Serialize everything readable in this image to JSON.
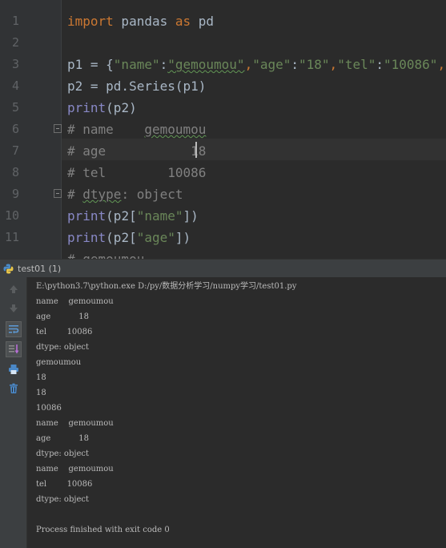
{
  "editor": {
    "line_numbers": [
      "1",
      "2",
      "3",
      "4",
      "5",
      "6",
      "7",
      "8",
      "9",
      "10",
      "11"
    ],
    "tokens": {
      "l1_import": "import",
      "l1_pandas": " pandas ",
      "l1_as": "as",
      "l1_pd": " pd",
      "l3_prefix": "p1 = {",
      "l3_k1": "\"name\"",
      "l3_c1": ":",
      "l3_v1": "\"gemoumou\"",
      "l3_s1": ",",
      "l3_k2": "\"age\"",
      "l3_c2": ":",
      "l3_v2": "\"18\"",
      "l3_s2": ",",
      "l3_k3": "\"tel\"",
      "l3_c3": ":",
      "l3_v3": "\"10086\"",
      "l3_s3": ",",
      "l3_end": "}",
      "l4": "p2 = pd.Series(p1)",
      "l5_print": "print",
      "l5_args": "(p2)",
      "l6_a": "# name    ",
      "l6_b": "gemoumou",
      "l7": "# age           18",
      "l8": "# tel        10086",
      "l9_a": "# ",
      "l9_b": "dtype",
      "l9_c": ": object",
      "l10_print": "print",
      "l10_a": "(p2[",
      "l10_s": "\"name\"",
      "l10_b": "])",
      "l11_print": "print",
      "l11_a": "(p2[",
      "l11_s": "\"age\"",
      "l11_b": "])",
      "l12": "# gemoumou"
    }
  },
  "run": {
    "tab_title": "test01 (1)",
    "toolbar_icons": [
      "arrow-up-icon",
      "arrow-down-icon",
      "soft-wrap-icon",
      "scroll-to-end-icon",
      "print-icon",
      "trash-icon"
    ],
    "output": [
      "E:\\python3.7\\python.exe D:/py/数据分析学习/numpy学习/test01.py",
      "name    gemoumou",
      "age           18",
      "tel        10086",
      "dtype: object",
      "gemoumou",
      "18",
      "18",
      "10086",
      "name    gemoumou",
      "age           18",
      "dtype: object",
      "name    gemoumou",
      "tel        10086",
      "dtype: object",
      "",
      "Process finished with exit code 0"
    ]
  },
  "colors": {
    "background": "#2b2b2b",
    "keyword": "#cc7832",
    "builtin": "#8888c6",
    "string": "#6a8759",
    "comment": "#808080",
    "text": "#a9b7c6"
  }
}
